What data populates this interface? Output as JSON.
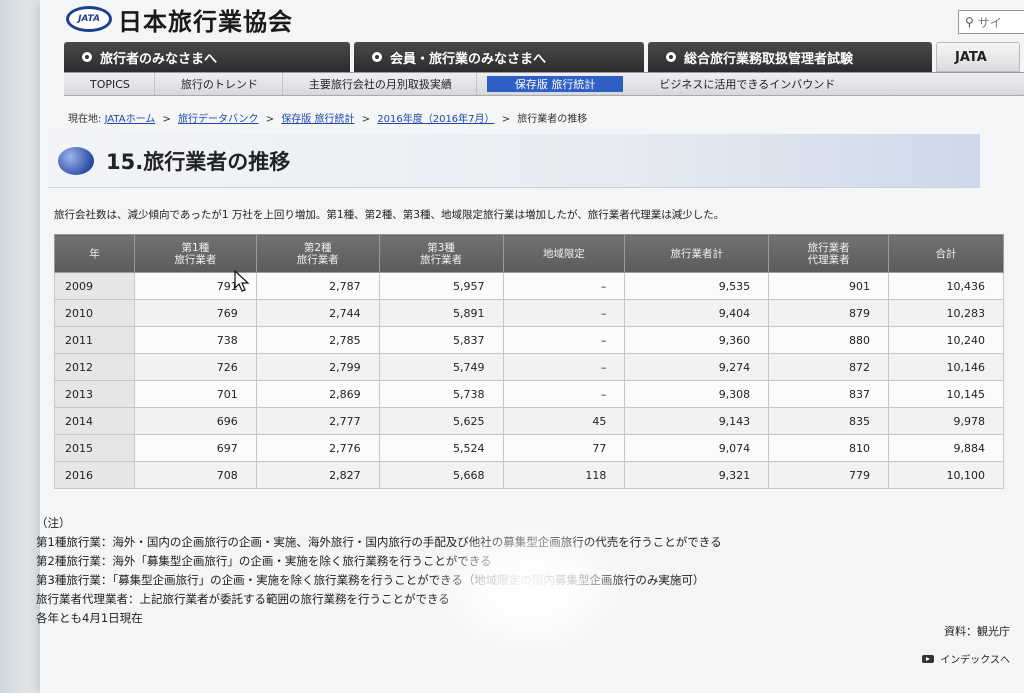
{
  "header": {
    "logo_text": "JATA",
    "site_name": "日本旅行業協会",
    "search_placeholder": "サイ"
  },
  "main_nav": [
    {
      "label": "旅行者のみなさまへ"
    },
    {
      "label": "会員・旅行業のみなさまへ"
    },
    {
      "label": "総合旅行業務取扱管理者試験"
    },
    {
      "label": "JATA"
    }
  ],
  "sub_nav": [
    {
      "label": "TOPICS"
    },
    {
      "label": "旅行のトレンド"
    },
    {
      "label": "主要旅行会社の月別取扱実績"
    },
    {
      "label": "保存版 旅行統計"
    },
    {
      "label": "ビジネスに活用できるインバウンド"
    }
  ],
  "breadcrumb": {
    "prefix": "現在地:",
    "items": [
      "JATAホーム",
      "旅行データバンク",
      "保存版 旅行統計",
      "2016年度（2016年7月）"
    ],
    "current": "旅行業者の推移",
    "separator": ">"
  },
  "page_title": "15.旅行業者の推移",
  "description": "旅行会社数は、減少傾向であったが1 万社を上回り増加。第1種、第2種、第3種、地域限定旅行業は増加したが、旅行業者代理業は減少した。",
  "table": {
    "headers": [
      "年",
      "第1種\n旅行業者",
      "第2種\n旅行業者",
      "第3種\n旅行業者",
      "地域限定",
      "旅行業者計",
      "旅行業者\n代理業者",
      "合計"
    ],
    "rows": [
      [
        "2009",
        "791",
        "2,787",
        "5,957",
        "–",
        "9,535",
        "901",
        "10,436"
      ],
      [
        "2010",
        "769",
        "2,744",
        "5,891",
        "–",
        "9,404",
        "879",
        "10,283"
      ],
      [
        "2011",
        "738",
        "2,785",
        "5,837",
        "–",
        "9,360",
        "880",
        "10,240"
      ],
      [
        "2012",
        "726",
        "2,799",
        "5,749",
        "–",
        "9,274",
        "872",
        "10,146"
      ],
      [
        "2013",
        "701",
        "2,869",
        "5,738",
        "–",
        "9,308",
        "837",
        "10,145"
      ],
      [
        "2014",
        "696",
        "2,777",
        "5,625",
        "45",
        "9,143",
        "835",
        "9,978"
      ],
      [
        "2015",
        "697",
        "2,776",
        "5,524",
        "77",
        "9,074",
        "810",
        "9,884"
      ],
      [
        "2016",
        "708",
        "2,827",
        "5,668",
        "118",
        "9,321",
        "779",
        "10,100"
      ]
    ]
  },
  "notes": {
    "heading": "（注）",
    "lines": [
      "第1種旅行業：海外・国内の企画旅行の企画・実施、海外旅行・国内旅行の手配及び他社の募集型企画旅行の代売を行うことができる",
      "第2種旅行業：海外「募集型企画旅行」の企画・実施を除く旅行業務を行うことができる",
      "第3種旅行業：「募集型企画旅行」の企画・実施を除く旅行業務を行うことができる（地域限定の国内募集型企画旅行のみ実施可）",
      "旅行業者代理業者：上記旅行業者が委託する範囲の旅行業務を行うことができる",
      "各年とも4月1日現在"
    ]
  },
  "source": "資料：観光庁",
  "index_link": "インデックスへ"
}
